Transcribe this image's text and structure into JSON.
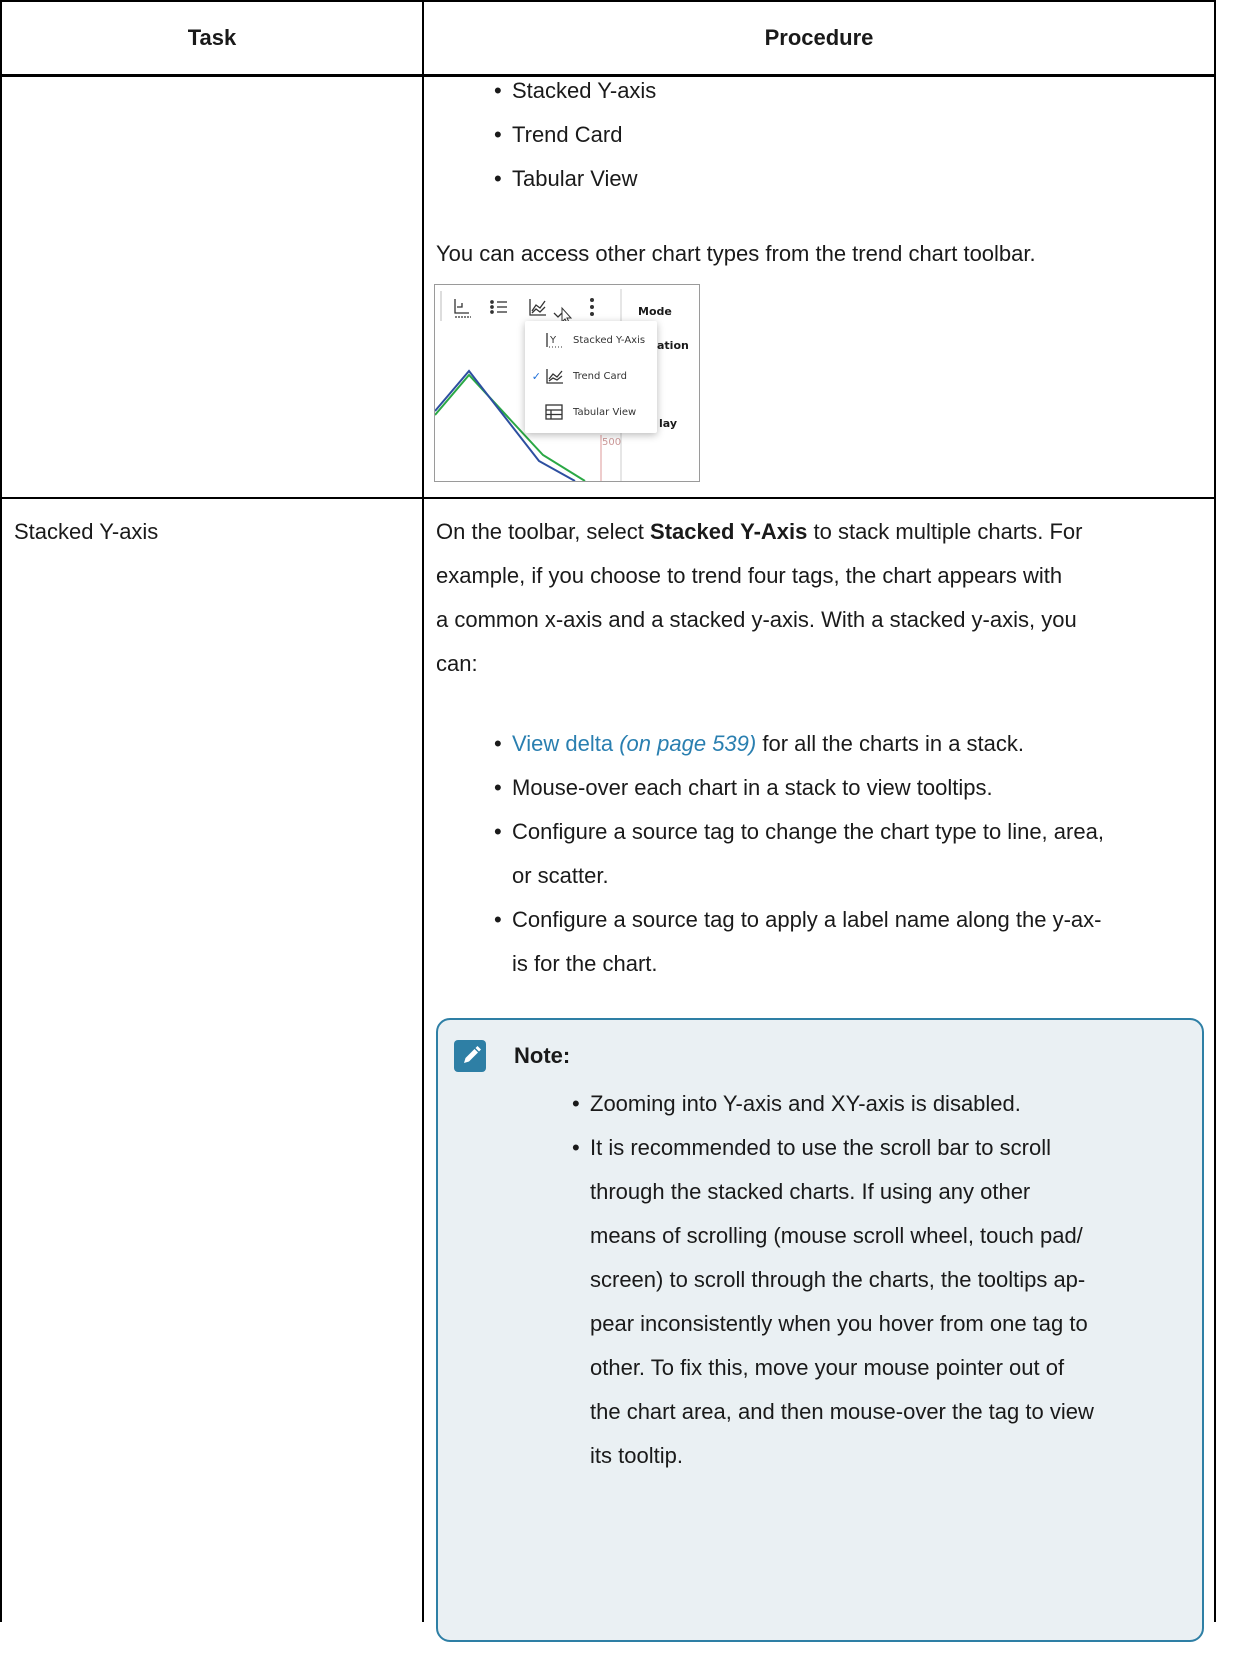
{
  "table": {
    "headers": {
      "task": "Task",
      "procedure": "Procedure"
    },
    "row1": {
      "chart_types": [
        "Stacked Y-axis",
        "Trend Card",
        "Tabular View"
      ],
      "access_text": "You can access other chart types from the trend chart toolbar."
    },
    "screenshot": {
      "side_labels": [
        "Mode",
        "ation",
        "lay",
        "500"
      ],
      "menu_items": [
        {
          "label": "Stacked Y-Axis",
          "checked": false,
          "icon": "stacked-y-axis-icon"
        },
        {
          "label": "Trend Card",
          "checked": true,
          "icon": "trend-card-icon"
        },
        {
          "label": "Tabular View",
          "checked": false,
          "icon": "tabular-view-icon"
        }
      ]
    },
    "row2": {
      "task": "Stacked Y-axis",
      "intro_before": "On the toolbar, select ",
      "intro_bold": "Stacked Y-Axis",
      "intro_lines": [
        " to stack multiple charts. For",
        "example, if you choose to trend four tags, the chart appears with",
        "a common x-axis and a stacked y-axis. With a stacked y-axis, you",
        "can:"
      ],
      "bullet1_link": "View delta",
      "bullet1_page": "(on page 539)",
      "bullet1_rest": " for all the charts in a stack.",
      "bullet2": "Mouse-over each chart in a stack to view tooltips.",
      "bullet3_line1": "Configure a source tag to change the chart type to line, area,",
      "bullet3_line2": "or scatter.",
      "bullet4_line1": "Configure a source tag to apply a label name along the y-ax-",
      "bullet4_line2": "is for the chart.",
      "note": {
        "title": "Note:",
        "item1": "Zooming into Y-axis and XY-axis is disabled.",
        "item2_lines": [
          "It is recommended to use the scroll bar to scroll",
          "through the stacked charts. If using any other",
          "means of scrolling (mouse scroll wheel, touch pad/",
          "screen) to scroll through the charts, the tooltips ap-",
          "pear inconsistently when you hover from one tag to",
          "other. To fix this, move your mouse pointer out of",
          "the chart area, and then mouse-over the tag to view",
          "its tooltip."
        ]
      }
    }
  }
}
